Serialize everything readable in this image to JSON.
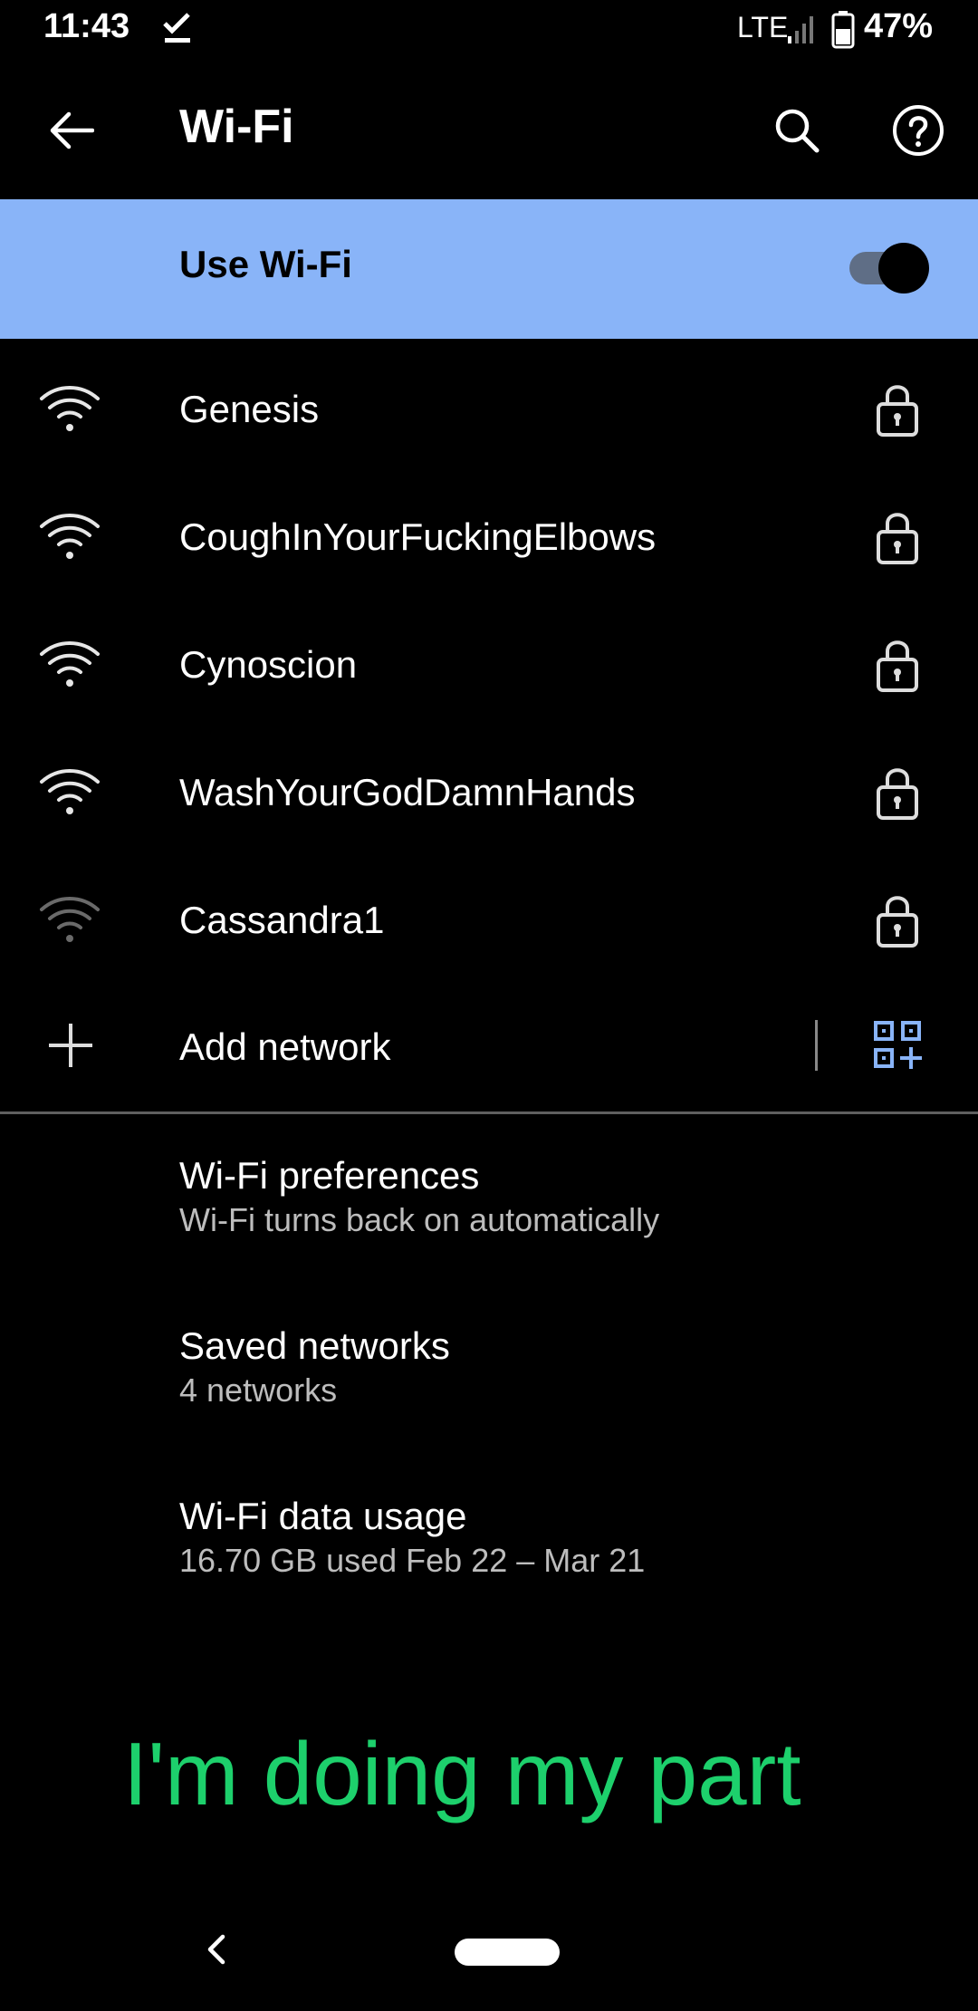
{
  "status_bar": {
    "time": "11:43",
    "network_type": "LTE",
    "battery": "47%",
    "icons": [
      "check-icon",
      "signal-icon",
      "battery-icon"
    ]
  },
  "app_bar": {
    "title": "Wi-Fi",
    "icons": [
      "back-arrow-icon",
      "search-icon",
      "help-icon"
    ]
  },
  "use_wifi": {
    "label": "Use Wi-Fi",
    "enabled": true,
    "accent": "#89B4F8"
  },
  "networks": [
    {
      "name": "Genesis",
      "signal": "strong",
      "secured": true
    },
    {
      "name": "CoughInYourFuckingElbows",
      "signal": "strong",
      "secured": true
    },
    {
      "name": "Cynoscion",
      "signal": "strong",
      "secured": true
    },
    {
      "name": "WashYourGodDamnHands",
      "signal": "strong",
      "secured": true
    },
    {
      "name": "Cassandra1",
      "signal": "weak",
      "secured": true
    }
  ],
  "add_network": {
    "label": "Add network",
    "icons": [
      "plus-icon",
      "qr-scan-icon"
    ]
  },
  "preferences": [
    {
      "title": "Wi-Fi preferences",
      "subtitle": "Wi-Fi turns back on automatically"
    },
    {
      "title": "Saved networks",
      "subtitle": "4 networks"
    },
    {
      "title": "Wi-Fi data usage",
      "subtitle": "16.70 GB used Feb 22 – Mar 21"
    }
  ],
  "banner": {
    "text": "I'm doing my part",
    "color": "#1DD06C"
  },
  "nav_bar": {
    "icons": [
      "nav-back-icon",
      "nav-home-pill"
    ]
  }
}
